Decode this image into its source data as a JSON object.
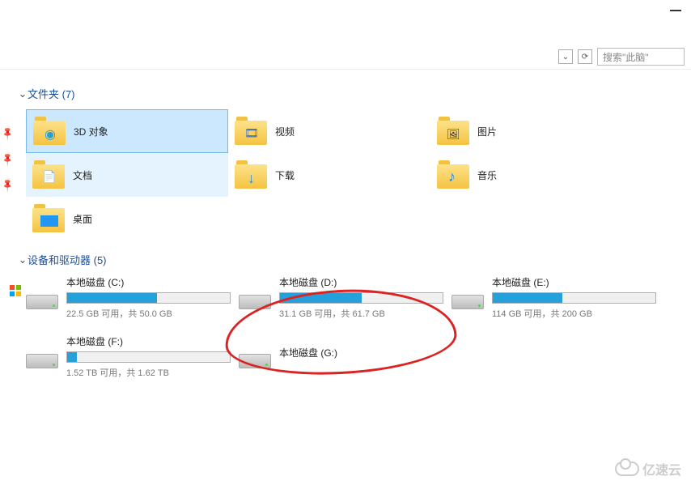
{
  "window": {
    "minimize": "—"
  },
  "toolbar": {
    "search_placeholder": "搜索\"此脑\"",
    "back": "⌄",
    "refresh": "⟳"
  },
  "sections": {
    "folders": {
      "title": "文件夹 (7)",
      "items": [
        {
          "label": "3D 对象",
          "icon": "3d-icon",
          "selected": true
        },
        {
          "label": "视频",
          "icon": "video-icon"
        },
        {
          "label": "图片",
          "icon": "pictures-icon"
        },
        {
          "label": "文档",
          "icon": "documents-icon",
          "hover": true
        },
        {
          "label": "下载",
          "icon": "downloads-icon"
        },
        {
          "label": "音乐",
          "icon": "music-icon"
        },
        {
          "label": "桌面",
          "icon": "desktop-icon"
        }
      ]
    },
    "drives": {
      "title": "设备和驱动器 (5)",
      "items": [
        {
          "name": "本地磁盘 (C:)",
          "stats": "22.5 GB 可用，共 50.0 GB",
          "fill": 55,
          "os": true
        },
        {
          "name": "本地磁盘 (D:)",
          "stats": "31.1 GB 可用，共 61.7 GB",
          "fill": 50
        },
        {
          "name": "本地磁盘 (E:)",
          "stats": "114 GB 可用，共 200 GB",
          "fill": 43
        },
        {
          "name": "本地磁盘 (F:)",
          "stats": "1.52 TB 可用，共 1.62 TB",
          "fill": 6
        },
        {
          "name": "本地磁盘 (G:)",
          "stats": "",
          "fill": null
        }
      ]
    }
  },
  "watermark": "亿速云"
}
